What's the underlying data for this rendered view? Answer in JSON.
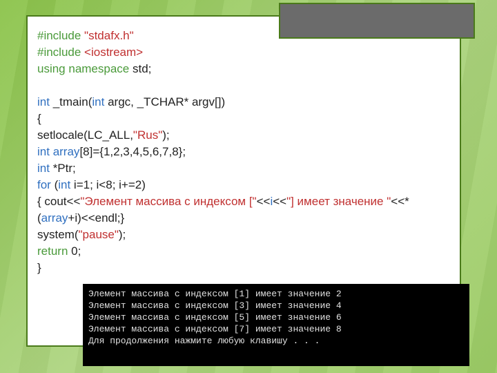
{
  "code": {
    "l1a": "#include",
    "l1b": " \"stdafx.h\"",
    "l2a": "#include",
    "l2b": " <iostream>",
    "l3a": "using namespace",
    "l3b": " std;",
    "l5a": "int",
    "l5b": " _tmain(",
    "l5c": "int",
    "l5d": " argc, _TCHAR* argv[])",
    "l6": "{",
    "l7a": "setlocale(LC_ALL,",
    "l7b": "\"Rus\"",
    "l7c": ");",
    "l8a": "int",
    "l8b": " array",
    "l8c": "[8]={1,2,3,4,5,6,7,8};",
    "l9a": "int",
    "l9b": " *Ptr;",
    "l10a": "for",
    "l10b": " (",
    "l10c": "int",
    "l10d": " i=1; i<8; i+=2)",
    "l11a": "{ cout<<",
    "l11b": "\"Элемент массива с индексом [\"",
    "l11c": "<<",
    "l11d": "i",
    "l11e": "<<",
    "l11f": "\"] имеет значение \"",
    "l11g": "<<*(",
    "l11h": "array",
    "l11i": "+i)<<endl;}",
    "l12a": "system(",
    "l12b": "\"pause\"",
    "l12c": ");",
    "l13a": "return",
    "l13b": " 0;",
    "l14": "}"
  },
  "console": {
    "lines": [
      "Элемент массива с индексом [1] имеет значение 2",
      "Элемент массива с индексом [3] имеет значение 4",
      "Элемент массива с индексом [5] имеет значение 6",
      "Элемент массива с индексом [7] имеет значение 8",
      "Для продолжения нажмите любую клавишу . . ."
    ]
  }
}
